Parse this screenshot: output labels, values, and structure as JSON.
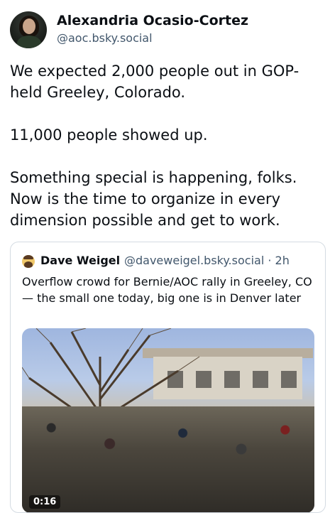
{
  "author": {
    "name": "Alexandria Ocasio-Cortez",
    "handle": "@aoc.bsky.social"
  },
  "post": {
    "paragraphs": [
      "We expected 2,000 people out in GOP-held Greeley, Colorado.",
      "11,000 people showed up.",
      "Something special is happening, folks. Now is the time to organize in every dimension possible and get to work."
    ]
  },
  "quote": {
    "author_name": "Dave Weigel",
    "handle_time": "@daveweigel.bsky.social · 2h",
    "text": "Overflow crowd for Bernie/AOC rally in Greeley, CO — the small one today, big one is in Denver later",
    "video": {
      "duration": "0:16"
    }
  }
}
